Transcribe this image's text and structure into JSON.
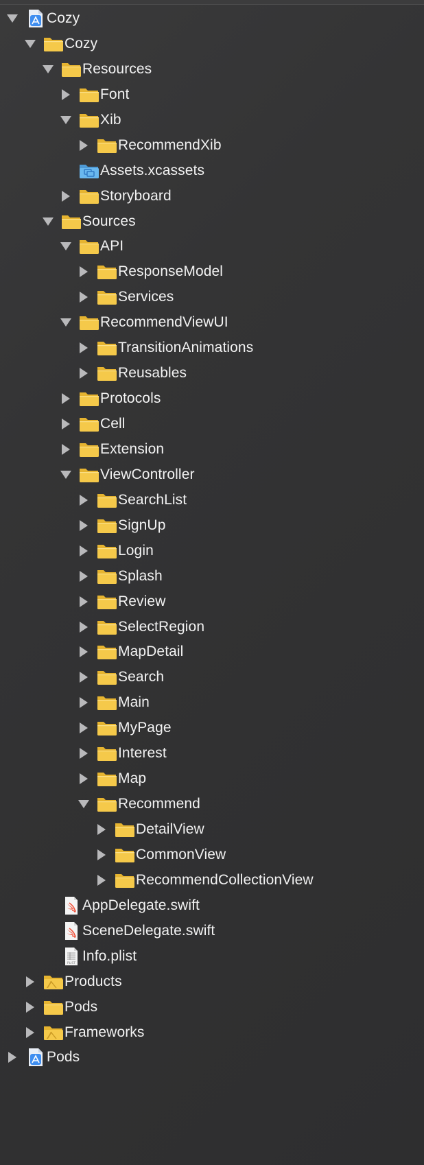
{
  "navigator": {
    "items": [
      {
        "label": "Cozy",
        "icon": "project-icon",
        "depth": 0,
        "disclosure": "expanded"
      },
      {
        "label": "Cozy",
        "icon": "folder-icon",
        "depth": 1,
        "disclosure": "expanded"
      },
      {
        "label": "Resources",
        "icon": "folder-icon",
        "depth": 2,
        "disclosure": "expanded"
      },
      {
        "label": "Font",
        "icon": "folder-icon",
        "depth": 3,
        "disclosure": "collapsed"
      },
      {
        "label": "Xib",
        "icon": "folder-icon",
        "depth": 3,
        "disclosure": "expanded"
      },
      {
        "label": "RecommendXib",
        "icon": "folder-icon",
        "depth": 4,
        "disclosure": "collapsed"
      },
      {
        "label": "Assets.xcassets",
        "icon": "asset-catalog-icon",
        "depth": 3,
        "disclosure": "none"
      },
      {
        "label": "Storyboard",
        "icon": "folder-icon",
        "depth": 3,
        "disclosure": "collapsed"
      },
      {
        "label": "Sources",
        "icon": "folder-icon",
        "depth": 2,
        "disclosure": "expanded"
      },
      {
        "label": "API",
        "icon": "folder-icon",
        "depth": 3,
        "disclosure": "expanded"
      },
      {
        "label": "ResponseModel",
        "icon": "folder-icon",
        "depth": 4,
        "disclosure": "collapsed"
      },
      {
        "label": "Services",
        "icon": "folder-icon",
        "depth": 4,
        "disclosure": "collapsed"
      },
      {
        "label": "RecommendViewUI",
        "icon": "folder-icon",
        "depth": 3,
        "disclosure": "expanded"
      },
      {
        "label": "TransitionAnimations",
        "icon": "folder-icon",
        "depth": 4,
        "disclosure": "collapsed"
      },
      {
        "label": "Reusables",
        "icon": "folder-icon",
        "depth": 4,
        "disclosure": "collapsed"
      },
      {
        "label": "Protocols",
        "icon": "folder-icon",
        "depth": 3,
        "disclosure": "collapsed"
      },
      {
        "label": "Cell",
        "icon": "folder-icon",
        "depth": 3,
        "disclosure": "collapsed"
      },
      {
        "label": "Extension",
        "icon": "folder-icon",
        "depth": 3,
        "disclosure": "collapsed"
      },
      {
        "label": "ViewController",
        "icon": "folder-icon",
        "depth": 3,
        "disclosure": "expanded"
      },
      {
        "label": "SearchList",
        "icon": "folder-icon",
        "depth": 4,
        "disclosure": "collapsed"
      },
      {
        "label": "SignUp",
        "icon": "folder-icon",
        "depth": 4,
        "disclosure": "collapsed"
      },
      {
        "label": "Login",
        "icon": "folder-icon",
        "depth": 4,
        "disclosure": "collapsed"
      },
      {
        "label": "Splash",
        "icon": "folder-icon",
        "depth": 4,
        "disclosure": "collapsed"
      },
      {
        "label": "Review",
        "icon": "folder-icon",
        "depth": 4,
        "disclosure": "collapsed"
      },
      {
        "label": "SelectRegion",
        "icon": "folder-icon",
        "depth": 4,
        "disclosure": "collapsed"
      },
      {
        "label": "MapDetail",
        "icon": "folder-icon",
        "depth": 4,
        "disclosure": "collapsed"
      },
      {
        "label": "Search",
        "icon": "folder-icon",
        "depth": 4,
        "disclosure": "collapsed"
      },
      {
        "label": "Main",
        "icon": "folder-icon",
        "depth": 4,
        "disclosure": "collapsed"
      },
      {
        "label": "MyPage",
        "icon": "folder-icon",
        "depth": 4,
        "disclosure": "collapsed"
      },
      {
        "label": "Interest",
        "icon": "folder-icon",
        "depth": 4,
        "disclosure": "collapsed"
      },
      {
        "label": "Map",
        "icon": "folder-icon",
        "depth": 4,
        "disclosure": "collapsed"
      },
      {
        "label": "Recommend",
        "icon": "folder-icon",
        "depth": 4,
        "disclosure": "expanded"
      },
      {
        "label": "DetailView",
        "icon": "folder-icon",
        "depth": 5,
        "disclosure": "collapsed"
      },
      {
        "label": "CommonView",
        "icon": "folder-icon",
        "depth": 5,
        "disclosure": "collapsed"
      },
      {
        "label": "RecommendCollectionView",
        "icon": "folder-icon",
        "depth": 5,
        "disclosure": "collapsed"
      },
      {
        "label": "AppDelegate.swift",
        "icon": "swift-file-icon",
        "depth": 2,
        "disclosure": "none"
      },
      {
        "label": "SceneDelegate.swift",
        "icon": "swift-file-icon",
        "depth": 2,
        "disclosure": "none"
      },
      {
        "label": "Info.plist",
        "icon": "plist-file-icon",
        "depth": 2,
        "disclosure": "none"
      },
      {
        "label": "Products",
        "icon": "products-folder-icon",
        "depth": 1,
        "disclosure": "collapsed"
      },
      {
        "label": "Pods",
        "icon": "folder-icon",
        "depth": 1,
        "disclosure": "collapsed"
      },
      {
        "label": "Frameworks",
        "icon": "products-folder-icon",
        "depth": 1,
        "disclosure": "collapsed"
      },
      {
        "label": "Pods",
        "icon": "project-icon",
        "depth": 0,
        "disclosure": "collapsed"
      }
    ]
  },
  "colors": {
    "background": "#333334",
    "text": "#f2f2f2",
    "disclosure": "#b9b9bb",
    "folder_front": "#f5c94a",
    "folder_back": "#e6b430",
    "asset_blue": "#6ab8ef",
    "project_blue": "#3f8ef0",
    "swift_orange": "#f0513a"
  }
}
